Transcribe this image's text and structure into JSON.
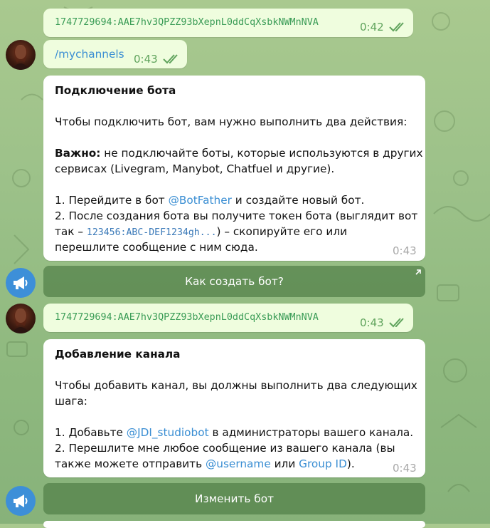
{
  "messages": {
    "token_1": {
      "text": "1747729694:AAE7hv3QPZZ93bXepnL0ddCqXsbkNWMnNVA",
      "time": "0:42"
    },
    "command": {
      "text": "/mychannels",
      "time": "0:43"
    },
    "connect_bot": {
      "title": "Подключение бота",
      "intro": "Чтобы подключить бот, вам нужно выполнить два действия:",
      "important_label": "Важно:",
      "important_line1": " не подключайте боты, которые используются в других",
      "important_line2": "сервисах (Livegram, Manybot, Chatfuel и другие).",
      "step1_prefix": "1. Перейдите в бот ",
      "step1_link": "@BotFather",
      "step1_suffix": " и создайте новый бот.",
      "step2_line1": "2. После создания бота вы получите токен бота (выглядит вот",
      "step2_prefix": "так – ",
      "step2_code": "123456:ABC-DEF1234gh...",
      "step2_suffix": ") – скопируйте его или",
      "step2_line3": "перешлите сообщение с ним сюда.",
      "time": "0:43"
    },
    "button_how": "Как создать бот?",
    "token_2": {
      "text": "1747729694:AAE7hv3QPZZ93bXepnL0ddCqXsbkNWMnNVA",
      "time": "0:43"
    },
    "add_channel": {
      "title": "Добавление канала",
      "intro_line1": "Чтобы добавить канал, вы должны выполнить два следующих",
      "intro_line2": "шага:",
      "step1_prefix": "1. Добавьте ",
      "step1_link": "@JDI_studiobot",
      "step1_suffix": " в администраторы вашего канала.",
      "step2_line1": "2. Перешлите мне любое сообщение из вашего канала (вы",
      "step2_prefix": "также можете отправить ",
      "step2_link1": "@username",
      "step2_mid": " или ",
      "step2_link2": "Group ID",
      "step2_suffix": ").",
      "time": "0:43"
    },
    "button_change": "Изменить бот"
  },
  "icons": {
    "read_receipt": "double-check-icon",
    "bot_avatar": "megaphone-icon",
    "external": "arrow-up-right-icon"
  },
  "colors": {
    "outgoing_bubble": "#effdde",
    "incoming_bubble": "#ffffff",
    "link": "#3a8ed3",
    "token_text": "#3a9c56",
    "bot_avatar": "#3d8fd8"
  }
}
